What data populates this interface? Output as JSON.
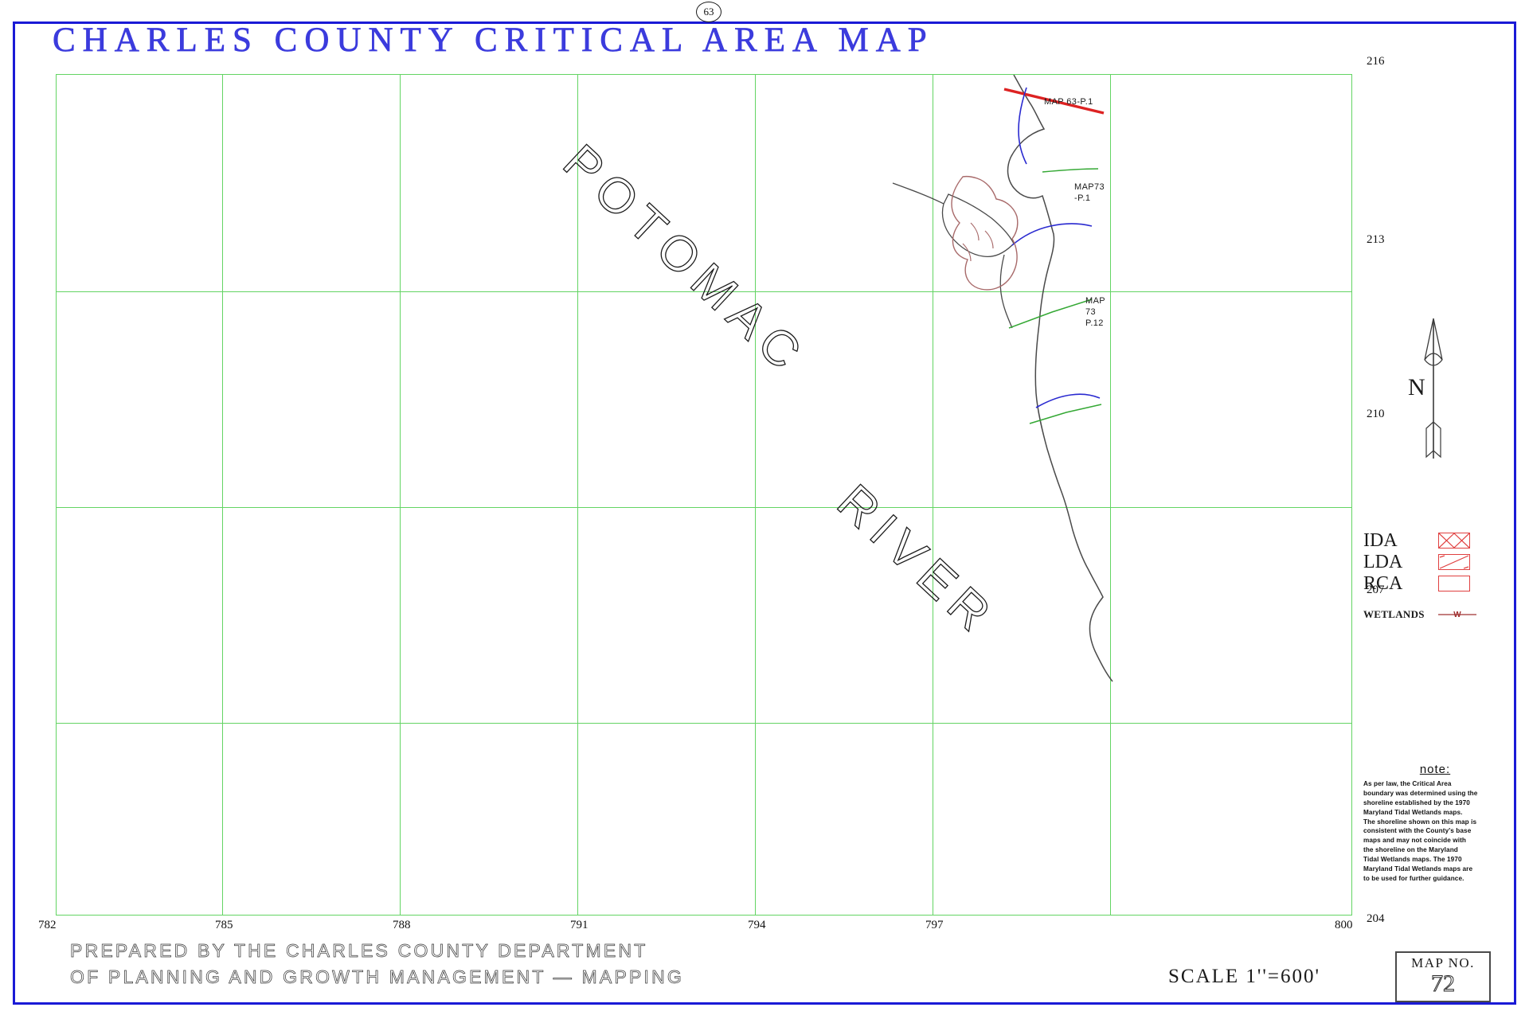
{
  "sheet": {
    "sheet_number": "63",
    "title": "CHARLES COUNTY CRITICAL AREA MAP",
    "border_color": "#1a1ad6",
    "grid_color": "#63d463"
  },
  "map": {
    "water_labels": [
      {
        "text": "POTOMAC",
        "name": "potomac"
      },
      {
        "text": "RIVER",
        "name": "river"
      }
    ],
    "tile_labels": [
      {
        "text": "MAP 63-P.1",
        "name": "map-63-p1"
      },
      {
        "text": "MAP73\n-P.1",
        "name": "map-73-p1"
      },
      {
        "text": "MAP\n73\nP.12",
        "name": "map-73-p12"
      }
    ],
    "axis": {
      "x_ticks": [
        "782",
        "785",
        "788",
        "791",
        "794",
        "797",
        "800"
      ],
      "y_ticks": [
        "216",
        "213",
        "210",
        "207",
        "204"
      ]
    },
    "feature_colors": {
      "shoreline": "#4a4a4a",
      "critical_area_red": "#dd2222",
      "critical_area_blue": "#2a2ad0",
      "wetland": "#a86a6a",
      "grid": "#63d463"
    }
  },
  "compass": {
    "label": "N"
  },
  "legend": {
    "items": [
      {
        "label": "IDA",
        "swatch": "crosshatch-box",
        "color": "#e04040"
      },
      {
        "label": "LDA",
        "swatch": "diagonal-box",
        "color": "#e04040"
      },
      {
        "label": "RCA",
        "swatch": "empty-box",
        "color": "#e04040"
      },
      {
        "label": "WETLANDS",
        "swatch": "wetland-line",
        "color": "#a03030"
      }
    ]
  },
  "note": {
    "heading": "note:",
    "lines": [
      "As per law, the Critical Area",
      "boundary was determined using the",
      "shoreline established by the 1970",
      "Maryland Tidal Wetlands maps.",
      "The shoreline shown on this map is",
      "consistent with the County's base",
      "maps and may not coincide with",
      "the shoreline on the Maryland",
      "Tidal Wetlands maps. The 1970",
      "Maryland Tidal Wetlands maps are",
      "to be used for further guidance."
    ]
  },
  "footer": {
    "credit_line_1": "PREPARED BY THE CHARLES COUNTY DEPARTMENT",
    "credit_line_2": "OF PLANNING AND GROWTH MANAGEMENT — MAPPING",
    "scale": "SCALE 1''=600'",
    "map_no_label": "MAP NO.",
    "map_no_value": "72"
  }
}
